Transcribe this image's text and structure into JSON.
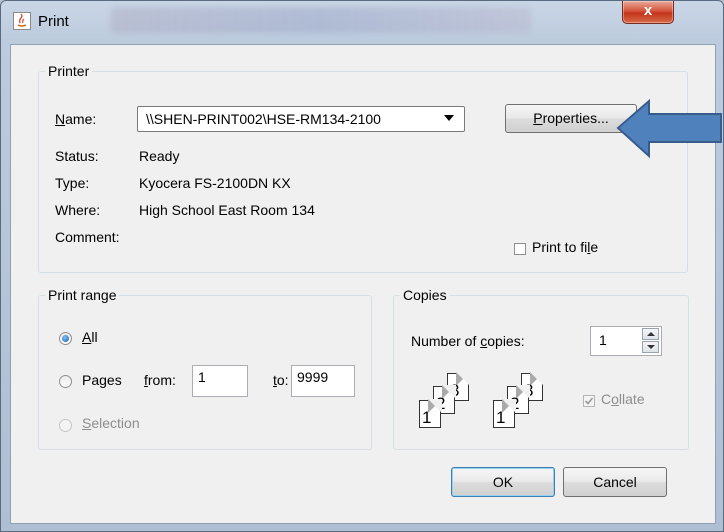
{
  "window": {
    "title": "Print",
    "close_glyph": "x"
  },
  "printer": {
    "legend": "Printer",
    "name_label": "Name:",
    "name_value": "\\\\SHEN-PRINT002\\HSE-RM134-2100",
    "properties_label": "Properties...",
    "status_label": "Status:",
    "status_value": "Ready",
    "type_label": "Type:",
    "type_value": "Kyocera FS-2100DN KX",
    "where_label": "Where:",
    "where_value": "High School East Room 134",
    "comment_label": "Comment:",
    "print_to_file_label": "Print to file",
    "print_to_file_checked": false
  },
  "print_range": {
    "legend": "Print range",
    "all_label": "All",
    "pages_label": "Pages",
    "from_label": "from:",
    "from_value": "1",
    "to_label": "to:",
    "to_value": "9999",
    "selection_label": "Selection",
    "selected": "all"
  },
  "copies": {
    "legend": "Copies",
    "number_label": "Number of copies:",
    "number_value": "1",
    "collate_label": "Collate",
    "collate_checked": true,
    "page_numbers": [
      "1",
      "2",
      "3"
    ]
  },
  "buttons": {
    "ok": "OK",
    "cancel": "Cancel"
  },
  "colors": {
    "arrow": "#4f81bd",
    "arrow_border": "#385d8a",
    "close_button": "#c3351c"
  }
}
